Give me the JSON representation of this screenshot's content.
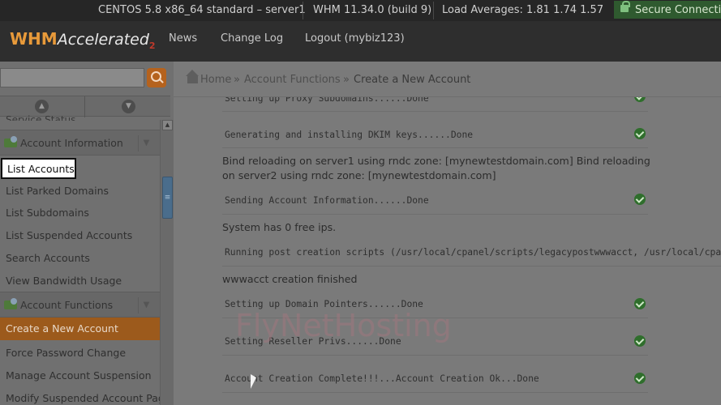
{
  "statusbar": {
    "server": "CENTOS 5.8 x86_64 standard – server1",
    "version": "WHM 11.34.0 (build 9)",
    "load": "Load Averages: 1.81 1.74 1.57",
    "secure": "Secure Connection"
  },
  "header": {
    "logo_whm": "WHM",
    "logo_acc": "Accelerated",
    "logo_two": "2",
    "nav": [
      "News",
      "Change Log",
      "Logout (mybiz123)"
    ]
  },
  "sidebar": {
    "partial_item": "Service Status",
    "group_account_info": "Account Information",
    "list_accounts": "List Accounts",
    "links": [
      "List Parked Domains",
      "List Subdomains",
      "List Suspended Accounts",
      "Search Accounts",
      "View Bandwidth Usage"
    ],
    "group_account_functions": "Account Functions",
    "active_item": "Create a New Account",
    "links2": [
      "Force Password Change",
      "Manage Account Suspension",
      "Modify Suspended Account Page"
    ]
  },
  "breadcrumb": {
    "home": "Home",
    "sep": "»",
    "section": "Account Functions",
    "current": "Create a New Account"
  },
  "log": {
    "proxy": "Setting up Proxy Subdomains......Done",
    "dkim": "Generating and installing DKIM keys......Done",
    "bind1": "Bind reloading on server1 using rndc zone: [mynewtestdomain.com] Bind reloading",
    "bind2": "on server2 using rndc zone: [mynewtestdomain.com]",
    "sending": "Sending Account Information......Done",
    "freeips": "System has 0 free ips.",
    "postscripts": "Running post creation scripts (/usr/local/cpanel/scripts/legacypostwwwacct, /usr/local/cpanel/",
    "finished": "wwwacct creation finished",
    "pointers": "Setting up Domain Pointers......Done",
    "reseller": "Setting Reseller Privs......Done",
    "complete": "Account Creation Complete!!!...Account Creation Ok...Done"
  },
  "watermark": "FlyNetHosting"
}
